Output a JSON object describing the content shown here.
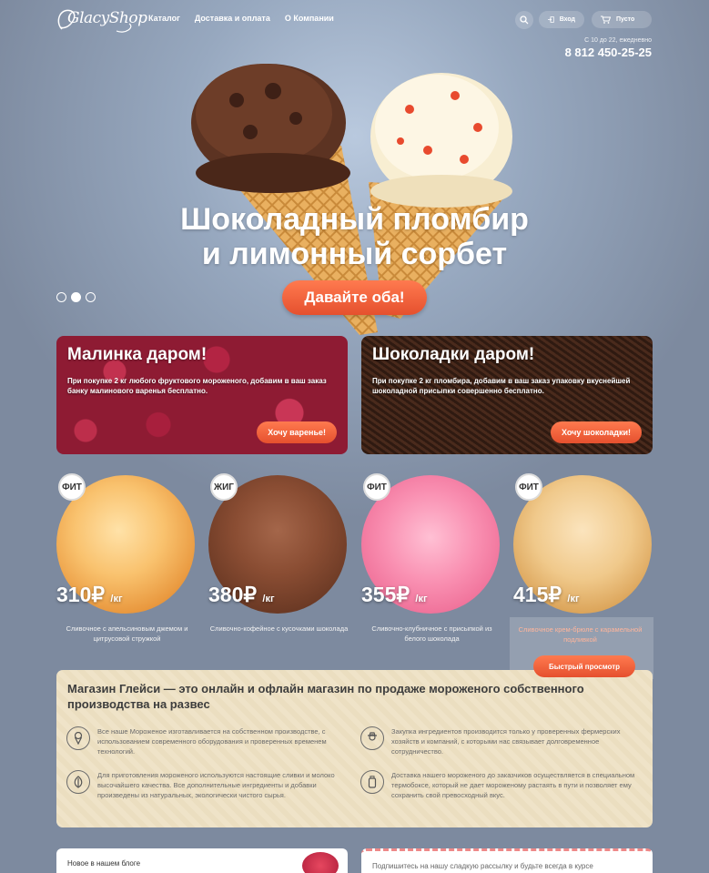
{
  "header": {
    "logo_text": "GlacyShop",
    "nav": [
      "Каталог",
      "Доставка и оплата",
      "О Компании"
    ],
    "login_label": "Вход",
    "cart_label": "Пусто",
    "hours": "С 10 до 22, ежедневно",
    "phone": "8 812 450-25-25"
  },
  "hero": {
    "title_line1": "Шоколадный пломбир",
    "title_line2": "и лимонный сорбет",
    "cta": "Давайте оба!",
    "slides": 3,
    "active_slide": 2
  },
  "promos": [
    {
      "title": "Малинка даром!",
      "text": "При покупке 2 кг любого фруктового мороженого, добавим в ваш заказ банку малинового варенья бесплатно.",
      "button": "Хочу варенье!"
    },
    {
      "title": "Шоколадки даром!",
      "text": "При покупке 2 кг пломбира, добавим в ваш заказ упаковку вкуснейшей шоколадной присыпки совершенно бесплатно.",
      "button": "Хочу шоколадки!"
    }
  ],
  "products": [
    {
      "badge": "ФИТ",
      "price": "310₽",
      "unit": "/кг",
      "desc": "Сливочное с апельсиновым джемом и цитрусовой стружкой"
    },
    {
      "badge": "ЖИГ",
      "price": "380₽",
      "unit": "/кг",
      "desc": "Сливочно-кофейное с кусочками шоколада"
    },
    {
      "badge": "ФИТ",
      "price": "355₽",
      "unit": "/кг",
      "desc": "Сливочно-клубничное с присыпкой из белого шоколада"
    },
    {
      "badge": "ФИТ",
      "price": "415₽",
      "unit": "/кг",
      "desc": "Сливочное крем-брюле с карамельной подливкой"
    }
  ],
  "quick_view": "Быстрый просмотр",
  "about": {
    "title": "Магазин Глейси — это онлайн и офлайн магазин по продаже мороженого собственного производства на развес",
    "features": [
      {
        "icon": "ice-cream-icon",
        "text": "Все наше Мороженое изготавливается на собственном производстве, с использованием современного оборудования и проверенных временем технологий."
      },
      {
        "icon": "farmer-icon",
        "text": "Закупка ингредиентов производится только у проверенных фермерских хозяйств и компаний, с которыми нас связывает долговременное сотрудничество."
      },
      {
        "icon": "leaf-icon",
        "text": "Для приготовления мороженого используются настоящие сливки и молоко высочайшего качества. Все дополнительные ингредиенты и добавки произведены из натуральных, экологически чистого сырья."
      },
      {
        "icon": "thermos-icon",
        "text": "Доставка нашего мороженого до заказчиков осуществляется в специальном термобоксе, который не дает мороженому растаять в пути и позволяет ему сохранить свой превосходный вкус."
      }
    ]
  },
  "bottom": {
    "blog_title": "Новое в нашем блоге",
    "news_text": "Подпишитесь на нашу сладкую рассылку и будьте всегда в курсе"
  }
}
